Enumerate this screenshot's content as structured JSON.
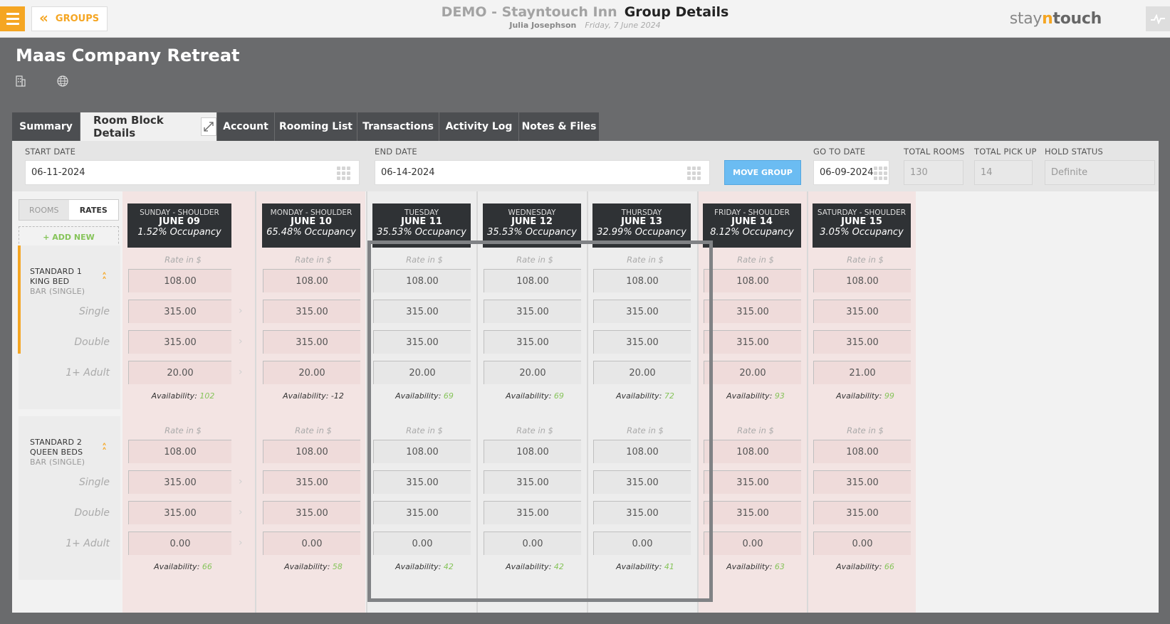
{
  "header": {
    "groups_label": "GROUPS",
    "hotel_name": "DEMO - Stayntouch Inn",
    "page_title": "Group Details",
    "user": "Julia Josephson",
    "business_date": "Friday, 7 June 2024",
    "logo_prefix": "stay",
    "logo_mid": "n",
    "logo_suffix": "touch"
  },
  "group": {
    "name": "Maas Company Retreat"
  },
  "tabs": [
    {
      "label": "Summary"
    },
    {
      "label": "Room Block Details",
      "active": true
    },
    {
      "label": "Account"
    },
    {
      "label": "Rooming List"
    },
    {
      "label": "Transactions"
    },
    {
      "label": "Activity Log"
    },
    {
      "label": "Notes & Files"
    }
  ],
  "filters": {
    "start_date_label": "START DATE",
    "start_date": "06-11-2024",
    "end_date_label": "END DATE",
    "end_date": "06-14-2024",
    "move_group_label": "MOVE GROUP",
    "go_to_date_label": "GO TO DATE",
    "go_to_date": "06-09-2024",
    "total_rooms_label": "TOTAL ROOMS",
    "total_rooms": "130",
    "total_pickup_label": "TOTAL PICK UP",
    "total_pickup": "14",
    "hold_status_label": "HOLD STATUS",
    "hold_status": "Definite"
  },
  "grid": {
    "toggle_rooms": "ROOMS",
    "toggle_rates": "RATES",
    "add_new": "+ ADD NEW",
    "rate_label": "Rate in $",
    "availability_label": "Availability:",
    "occupancy_labels": [
      "Single",
      "Double",
      "1+ Adult"
    ],
    "days": [
      {
        "name": "SUNDAY - SHOULDER",
        "date": "JUNE 09",
        "occupancy": "1.52% Occupancy",
        "weekend": true
      },
      {
        "name": "MONDAY - SHOULDER",
        "date": "JUNE 10",
        "occupancy": "65.48% Occupancy",
        "weekend": true
      },
      {
        "name": "TUESDAY",
        "date": "JUNE 11",
        "occupancy": "35.53% Occupancy",
        "weekend": false
      },
      {
        "name": "WEDNESDAY",
        "date": "JUNE 12",
        "occupancy": "35.53% Occupancy",
        "weekend": false
      },
      {
        "name": "THURSDAY",
        "date": "JUNE 13",
        "occupancy": "32.99% Occupancy",
        "weekend": false
      },
      {
        "name": "FRIDAY - SHOULDER",
        "date": "JUNE 14",
        "occupancy": "8.12% Occupancy",
        "weekend": true
      },
      {
        "name": "SATURDAY - SHOULDER",
        "date": "JUNE 15",
        "occupancy": "3.05% Occupancy",
        "weekend": true
      }
    ],
    "room_types": [
      {
        "name": "STANDARD 1 KING BED",
        "rate_plan": "BAR (SINGLE)",
        "rates": [
          "108.00",
          "108.00",
          "108.00",
          "108.00",
          "108.00",
          "108.00",
          "108.00"
        ],
        "single": [
          "315.00",
          "315.00",
          "315.00",
          "315.00",
          "315.00",
          "315.00",
          "315.00"
        ],
        "double": [
          "315.00",
          "315.00",
          "315.00",
          "315.00",
          "315.00",
          "315.00",
          "315.00"
        ],
        "extra_adult": [
          "20.00",
          "20.00",
          "20.00",
          "20.00",
          "20.00",
          "20.00",
          "21.00"
        ],
        "availability": [
          "102",
          "-12",
          "69",
          "69",
          "72",
          "93",
          "99"
        ]
      },
      {
        "name": "STANDARD 2 QUEEN BEDS",
        "rate_plan": "BAR (SINGLE)",
        "rates": [
          "108.00",
          "108.00",
          "108.00",
          "108.00",
          "108.00",
          "108.00",
          "108.00"
        ],
        "single": [
          "315.00",
          "315.00",
          "315.00",
          "315.00",
          "315.00",
          "315.00",
          "315.00"
        ],
        "double": [
          "315.00",
          "315.00",
          "315.00",
          "315.00",
          "315.00",
          "315.00",
          "315.00"
        ],
        "extra_adult": [
          "0.00",
          "0.00",
          "0.00",
          "0.00",
          "0.00",
          "0.00",
          "0.00"
        ],
        "availability": [
          "66",
          "58",
          "42",
          "42",
          "41",
          "63",
          "66"
        ]
      }
    ]
  }
}
